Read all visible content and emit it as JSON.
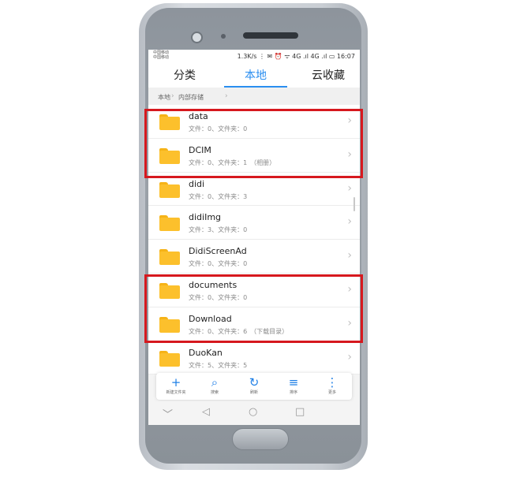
{
  "status": {
    "carrier_1": "中国移动",
    "carrier_2": "中国移动",
    "right_text": "1.3K/s ⋮ ✉ ⏰ ᯤ 4G .ıl 4G .ıl ▭ 16:07"
  },
  "tabs": [
    {
      "label": "分类"
    },
    {
      "label": "本地",
      "active": true
    },
    {
      "label": "云收藏"
    }
  ],
  "breadcrumb": {
    "items": [
      "本地",
      "内部存储"
    ],
    "separator": "›"
  },
  "files": [
    {
      "name": "data",
      "meta": "文件：0、文件夹：0"
    },
    {
      "name": "DCIM",
      "meta": "文件：0、文件夹：1　（相册）"
    },
    {
      "name": "didi",
      "meta": "文件：0、文件夹：3"
    },
    {
      "name": "didiImg",
      "meta": "文件：3、文件夹：0"
    },
    {
      "name": "DidiScreenAd",
      "meta": "文件：0、文件夹：0"
    },
    {
      "name": "documents",
      "meta": "文件：0、文件夹：0"
    },
    {
      "name": "Download",
      "meta": "文件：0、文件夹：6　（下载目录）"
    },
    {
      "name": "DuoKan",
      "meta": "文件：5、文件夹：5"
    }
  ],
  "toolbar": {
    "new_folder": {
      "icon": "+",
      "label": "新建文件夹"
    },
    "search": {
      "icon": "⌕",
      "label": "搜索"
    },
    "refresh": {
      "icon": "↻",
      "label": "刷新"
    },
    "sort": {
      "icon": "≡",
      "label": "排序"
    },
    "more": {
      "icon": "⋮",
      "label": "更多"
    }
  },
  "navbar": {
    "down": "﹀",
    "back": "◁",
    "home": "○",
    "recent": "□"
  },
  "colors": {
    "accent": "#2a8ef0",
    "highlight": "#d6181e",
    "folder": "#fcc02c"
  }
}
